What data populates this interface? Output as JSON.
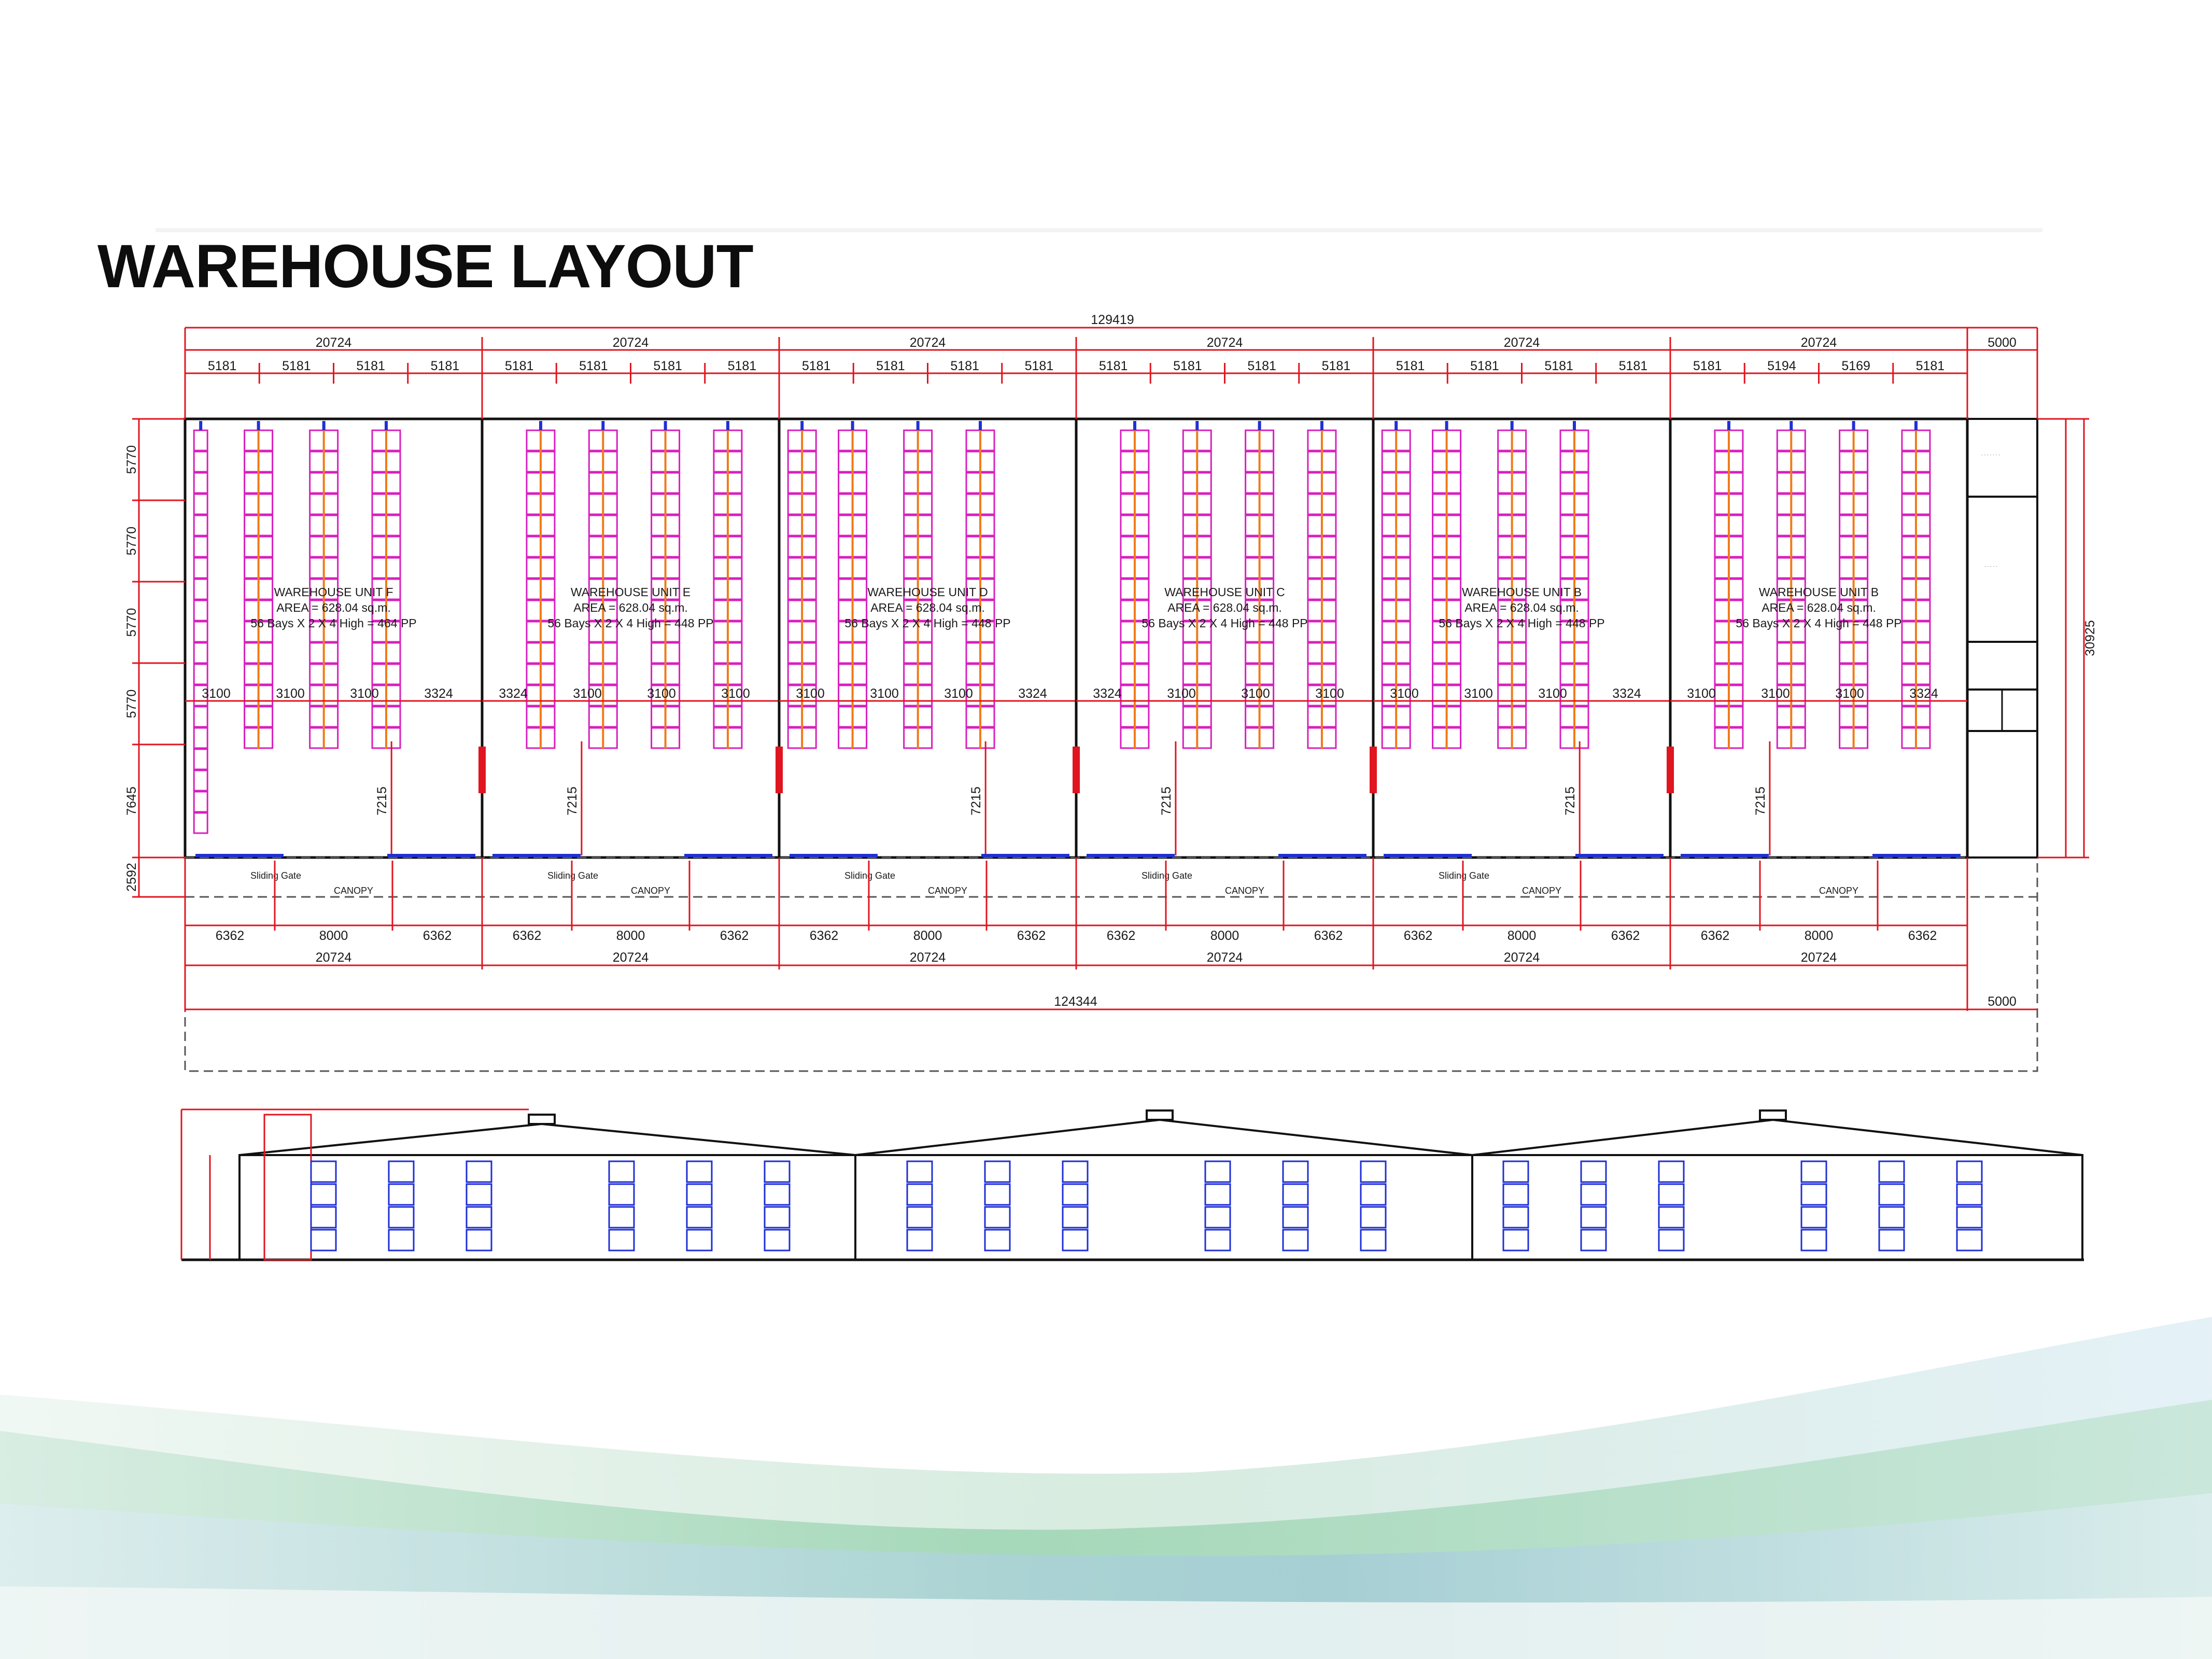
{
  "slide": {
    "title": "WAREHOUSE LAYOUT"
  },
  "colors": {
    "dimension": "#e0151f",
    "rack": "#d81fbf",
    "beam": "#f07a1a",
    "wall": "#111111",
    "door": "#1f2fd6",
    "wave_green": "#8fcfa8",
    "wave_blue": "#9fc6e0"
  },
  "plan": {
    "total_length": "129419",
    "office_width_top": "5000",
    "office_width_bottom": "5000",
    "bottom_total": "124344",
    "height_total": "30925",
    "left_dims": [
      "5770",
      "5770",
      "5770",
      "5770",
      "7645",
      "2592"
    ],
    "canopy_label": "CANOPY",
    "gate_label": "Sliding Gate",
    "dock_depth": "7215",
    "units": [
      {
        "id": "F",
        "width": "20724",
        "bays": [
          "5181",
          "5181",
          "5181",
          "5181"
        ],
        "aisles": [
          "3100",
          "3100",
          "3100",
          "3324"
        ],
        "label_name": "WAREHOUSE UNIT F",
        "label_area": "AREA = 628.04 sq.m.",
        "label_racks": "56 Bays X 2 X 4 High = 464 PP",
        "bottom": [
          "6362",
          "8000",
          "6362"
        ]
      },
      {
        "id": "E",
        "width": "20724",
        "bays": [
          "5181",
          "5181",
          "5181",
          "5181"
        ],
        "aisles": [
          "3324",
          "3100",
          "3100",
          "3100"
        ],
        "label_name": "WAREHOUSE UNIT E",
        "label_area": "AREA = 628.04 sq.m.",
        "label_racks": "56 Bays X 2 X 4 High = 448 PP",
        "bottom": [
          "6362",
          "8000",
          "6362"
        ]
      },
      {
        "id": "D",
        "width": "20724",
        "bays": [
          "5181",
          "5181",
          "5181",
          "5181"
        ],
        "aisles": [
          "3100",
          "3100",
          "3100",
          "3324"
        ],
        "label_name": "WAREHOUSE UNIT D",
        "label_area": "AREA = 628.04 sq.m.",
        "label_racks": "56 Bays X 2 X 4 High = 448 PP",
        "bottom": [
          "6362",
          "8000",
          "6362"
        ]
      },
      {
        "id": "C",
        "width": "20724",
        "bays": [
          "5181",
          "5181",
          "5181",
          "5181"
        ],
        "aisles": [
          "3324",
          "3100",
          "3100",
          "3100"
        ],
        "label_name": "WAREHOUSE UNIT C",
        "label_area": "AREA = 628.04 sq.m.",
        "label_racks": "56 Bays X 2 X 4 High = 448 PP",
        "bottom": [
          "6362",
          "8000",
          "6362"
        ]
      },
      {
        "id": "B",
        "width": "20724",
        "bays": [
          "5181",
          "5181",
          "5181",
          "5181"
        ],
        "aisles": [
          "3100",
          "3100",
          "3100",
          "3324"
        ],
        "label_name": "WAREHOUSE UNIT B",
        "label_area": "AREA = 628.04 sq.m.",
        "label_racks": "56 Bays X 2 X 4 High = 448 PP",
        "bottom": [
          "6362",
          "8000",
          "6362"
        ]
      },
      {
        "id": "B2",
        "width": "20724",
        "bays": [
          "5181",
          "5194",
          "5169",
          "5181"
        ],
        "aisles": [
          "3100",
          "3100",
          "3100",
          "3324"
        ],
        "label_name": "WAREHOUSE UNIT B",
        "label_area": "AREA = 628.04 sq.m.",
        "label_racks": "56 Bays X 2 X 4 High = 448 PP",
        "bottom": [
          "6362",
          "8000",
          "6362"
        ]
      }
    ]
  }
}
